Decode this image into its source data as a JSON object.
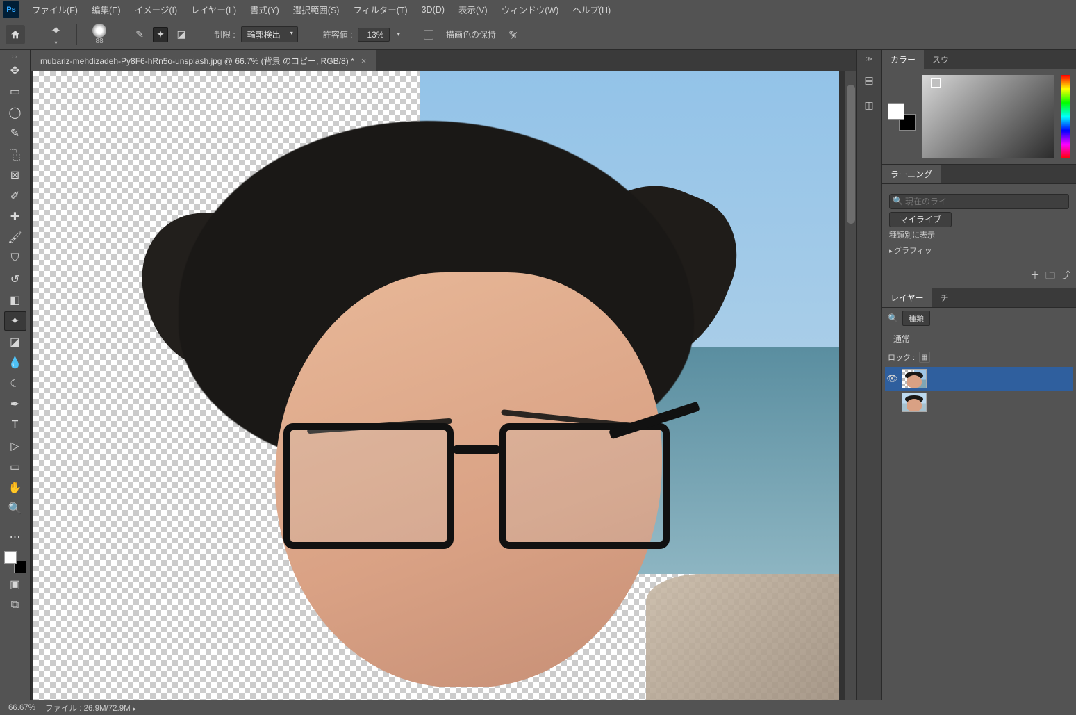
{
  "menubar": {
    "items": [
      "ファイル(F)",
      "編集(E)",
      "イメージ(I)",
      "レイヤー(L)",
      "書式(Y)",
      "選択範囲(S)",
      "フィルター(T)",
      "3D(D)",
      "表示(V)",
      "ウィンドウ(W)",
      "ヘルプ(H)"
    ]
  },
  "optbar": {
    "brush_size": "88",
    "limit_label": "制限 :",
    "limit_value": "輪郭検出",
    "tolerance_label": "許容値 :",
    "tolerance_value": "13%",
    "protect_fg_label": "描画色の保持"
  },
  "doc": {
    "tab_title": "mubariz-mehdizadeh-Py8F6-hRn5o-unsplash.jpg @ 66.7% (背景 のコピー, RGB/8) *"
  },
  "panels": {
    "color_tab": "カラー",
    "swatch_tab": "スウ",
    "learning_tab": "ラーニング",
    "search_placeholder": "現在のライ",
    "mylib_btn": "マイライブ",
    "typeview_label": "種類別に表示",
    "graphics_item": "グラフィッ",
    "layers_tab": "レイヤー",
    "channels_tab": "チ",
    "filter_label": "種類",
    "blend_mode": "通常",
    "lock_label": "ロック :"
  },
  "status": {
    "zoom": "66.67%",
    "doc_info": "ファイル : 26.9M/72.9M"
  },
  "tools": {
    "list": [
      "move",
      "marquee",
      "lasso",
      "quick-select",
      "crop",
      "frame",
      "eyedropper",
      "healing",
      "brush",
      "clone",
      "history-brush",
      "eraser",
      "bg-eraser",
      "gradient",
      "blur",
      "dodge",
      "pen",
      "type",
      "path-select",
      "rectangle",
      "hand",
      "zoom"
    ]
  }
}
